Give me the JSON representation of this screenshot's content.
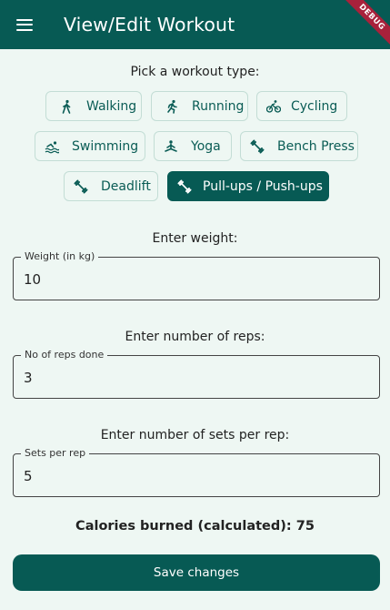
{
  "appbar": {
    "title": "View/Edit Workout",
    "debug_banner": "DEBUG"
  },
  "workout": {
    "prompt": "Pick a workout type:",
    "types": [
      {
        "label": "Walking",
        "icon": "walking-icon",
        "selected": false
      },
      {
        "label": "Running",
        "icon": "running-icon",
        "selected": false
      },
      {
        "label": "Cycling",
        "icon": "cycling-icon",
        "selected": false
      },
      {
        "label": "Swimming",
        "icon": "swimming-icon",
        "selected": false
      },
      {
        "label": "Yoga",
        "icon": "yoga-icon",
        "selected": false
      },
      {
        "label": "Bench Press",
        "icon": "dumbbell-icon",
        "selected": false
      },
      {
        "label": "Deadlift",
        "icon": "dumbbell-icon",
        "selected": false
      },
      {
        "label": "Pull-ups / Push-ups",
        "icon": "dumbbell-icon",
        "selected": true
      }
    ]
  },
  "weight": {
    "prompt": "Enter weight:",
    "label": "Weight (in kg)",
    "value": "10"
  },
  "reps": {
    "prompt": "Enter number of reps:",
    "label": "No of reps done",
    "value": "3"
  },
  "sets": {
    "prompt": "Enter number of sets per rep:",
    "label": "Sets per rep",
    "value": "5"
  },
  "calories": {
    "text": "Calories burned (calculated): 75"
  },
  "actions": {
    "save_label": "Save changes"
  },
  "colors": {
    "primary": "#075a54",
    "background": "#eef7f3",
    "debug": "#a8213b"
  }
}
